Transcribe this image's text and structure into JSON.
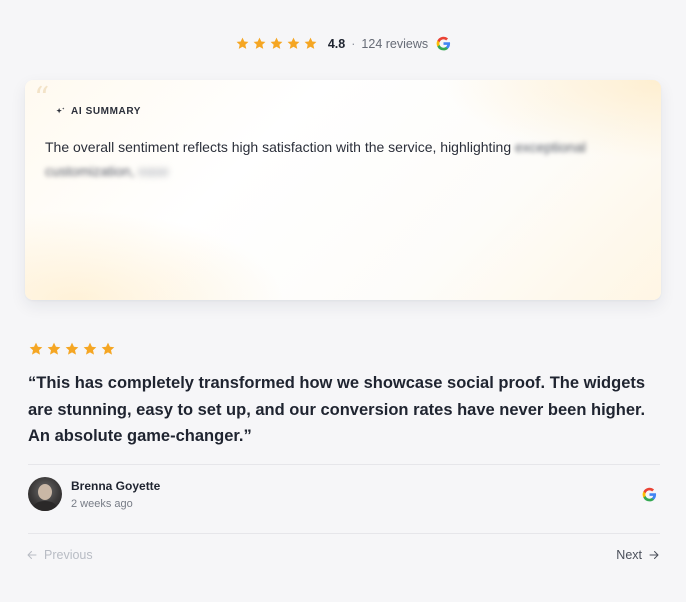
{
  "summary": {
    "rating": "4.8",
    "separator": "·",
    "reviews_count": "124 reviews",
    "stars": 5,
    "star_color": "#f5a623",
    "source_icon": "google-icon"
  },
  "ai_summary": {
    "label": "AI SUMMARY",
    "icon": "sparkle-icon",
    "text_visible": "The overall sentiment reflects high satisfaction with the service, highlighting ",
    "text_blurred": "exceptional customization,",
    "text_faded": "ease"
  },
  "review": {
    "stars": 5,
    "quote": "“This has completely transformed how we showcase social proof. The widgets are stunning, easy to set up, and our conversion rates have never been higher. An absolute game-changer.”",
    "author": {
      "name": "Brenna Goyette",
      "time": "2 weeks ago"
    },
    "source_icon": "google-icon"
  },
  "nav": {
    "prev_label": "Previous",
    "next_label": "Next"
  }
}
